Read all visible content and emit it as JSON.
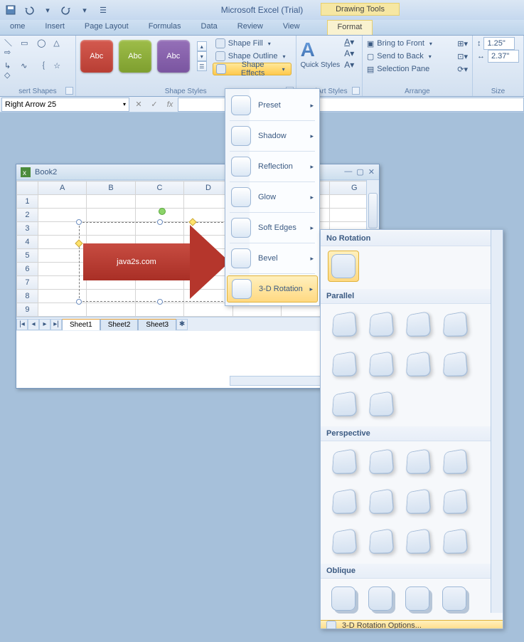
{
  "app_title": "Microsoft Excel (Trial)",
  "context_tool_title": "Drawing Tools",
  "tabs": {
    "home": "ome",
    "insert": "Insert",
    "pagelayout": "Page Layout",
    "formulas": "Formulas",
    "data": "Data",
    "review": "Review",
    "view": "View",
    "format": "Format"
  },
  "groups": {
    "insert_shapes": "sert Shapes",
    "shape_styles": "Shape Styles",
    "wordart": "rdArt Styles",
    "arrange": "Arrange",
    "size": "Size"
  },
  "shape_menu": {
    "fill": "Shape Fill",
    "outline": "Shape Outline",
    "effects": "Shape Effects"
  },
  "style_sample_label": "Abc",
  "quick_styles": "Quick Styles",
  "arrange": {
    "front": "Bring to Front",
    "back": "Send to Back",
    "pane": "Selection Pane"
  },
  "size": {
    "h": "1.25\"",
    "w": "2.37\""
  },
  "namebox": "Right Arrow 25",
  "fx_label": "fx",
  "workbook": {
    "title": "Book2",
    "columns": [
      "A",
      "B",
      "C",
      "D",
      "",
      "",
      "G"
    ],
    "rows": [
      "1",
      "2",
      "3",
      "4",
      "5",
      "6",
      "7",
      "8",
      "9"
    ],
    "shape_text": "java2s.com",
    "sheets": {
      "s1": "Sheet1",
      "s2": "Sheet2",
      "s3": "Sheet3"
    }
  },
  "effects_menu": {
    "preset": "Preset",
    "shadow": "Shadow",
    "reflection": "Reflection",
    "glow": "Glow",
    "softedges": "Soft Edges",
    "bevel": "Bevel",
    "rotation": "3-D Rotation"
  },
  "gallery": {
    "no_rotation": "No Rotation",
    "parallel": "Parallel",
    "perspective": "Perspective",
    "oblique": "Oblique",
    "options": "3-D Rotation Options..."
  }
}
